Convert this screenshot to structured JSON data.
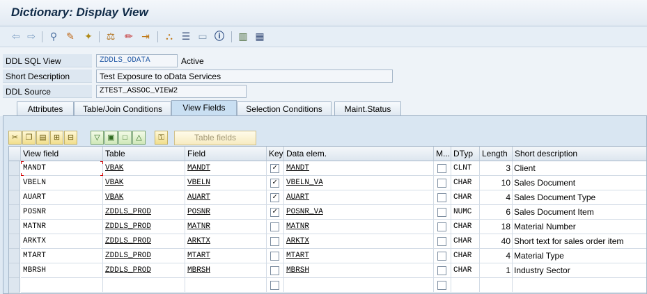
{
  "window": {
    "title": "Dictionary: Display View"
  },
  "toolbar": {
    "icons": [
      "back-arrow-icon",
      "forward-arrow-icon",
      "other-object-icon",
      "display-change-icon",
      "activate-icon",
      "where-used-icon",
      "edit-icon",
      "navigate-icon",
      "hierarchy-icon",
      "display-object-list-icon",
      "layout-icon",
      "information-icon",
      "table-structure-icon",
      "columns-icon"
    ]
  },
  "header": {
    "ddl_sql_view_label": "DDL SQL View",
    "ddl_sql_view_value": "ZDDLS_ODATA",
    "status": "Active",
    "short_description_label": "Short Description",
    "short_description_value": "Test Exposure to oData Services",
    "ddl_source_label": "DDL Source",
    "ddl_source_value": "ZTEST_ASSOC_VIEW2"
  },
  "tabs": [
    {
      "label": "Attributes",
      "active": false
    },
    {
      "label": "Table/Join Conditions",
      "active": false
    },
    {
      "label": "View Fields",
      "active": true
    },
    {
      "label": "Selection Conditions",
      "active": false
    },
    {
      "label": "Maint.Status",
      "active": false
    }
  ],
  "table_toolbar": {
    "table_fields_label": "Table fields"
  },
  "grid": {
    "columns": [
      "View field",
      "Table",
      "Field",
      "Key",
      "Data elem.",
      "M...",
      "DTyp",
      "Length",
      "Short description"
    ],
    "rows": [
      {
        "view_field": "MANDT",
        "table": "VBAK",
        "field": "MANDT",
        "key": true,
        "data_elem": "MANDT",
        "m": false,
        "dtyp": "CLNT",
        "length": "3",
        "short_desc": "Client"
      },
      {
        "view_field": "VBELN",
        "table": "VBAK",
        "field": "VBELN",
        "key": true,
        "data_elem": "VBELN_VA",
        "m": false,
        "dtyp": "CHAR",
        "length": "10",
        "short_desc": "Sales Document"
      },
      {
        "view_field": "AUART",
        "table": "VBAK",
        "field": "AUART",
        "key": true,
        "data_elem": "AUART",
        "m": false,
        "dtyp": "CHAR",
        "length": "4",
        "short_desc": "Sales Document Type"
      },
      {
        "view_field": "POSNR",
        "table": "ZDDLS_PROD",
        "field": "POSNR",
        "key": true,
        "data_elem": "POSNR_VA",
        "m": false,
        "dtyp": "NUMC",
        "length": "6",
        "short_desc": "Sales Document Item"
      },
      {
        "view_field": "MATNR",
        "table": "ZDDLS_PROD",
        "field": "MATNR",
        "key": false,
        "data_elem": "MATNR",
        "m": false,
        "dtyp": "CHAR",
        "length": "18",
        "short_desc": "Material Number"
      },
      {
        "view_field": "ARKTX",
        "table": "ZDDLS_PROD",
        "field": "ARKTX",
        "key": false,
        "data_elem": "ARKTX",
        "m": false,
        "dtyp": "CHAR",
        "length": "40",
        "short_desc": "Short text for sales order item"
      },
      {
        "view_field": "MTART",
        "table": "ZDDLS_PROD",
        "field": "MTART",
        "key": false,
        "data_elem": "MTART",
        "m": false,
        "dtyp": "CHAR",
        "length": "4",
        "short_desc": "Material Type"
      },
      {
        "view_field": "MBRSH",
        "table": "ZDDLS_PROD",
        "field": "MBRSH",
        "key": false,
        "data_elem": "MBRSH",
        "m": false,
        "dtyp": "CHAR",
        "length": "1",
        "short_desc": "Industry Sector"
      },
      {
        "view_field": "",
        "table": "",
        "field": "",
        "key": false,
        "data_elem": "",
        "m": false,
        "dtyp": "",
        "length": "",
        "short_desc": ""
      }
    ]
  }
}
